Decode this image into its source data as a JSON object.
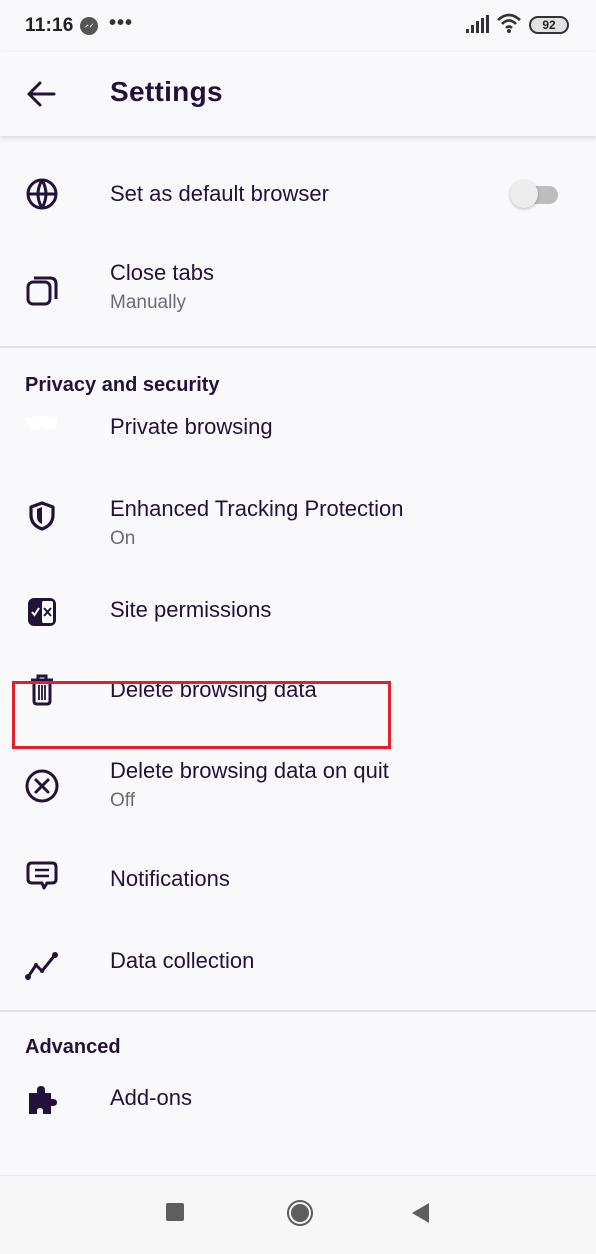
{
  "status_bar": {
    "time": "11:16",
    "overflow": "•••",
    "battery": "92",
    "icons": [
      "messenger-icon",
      "more-dots-icon",
      "signal-icon",
      "wifi-icon",
      "battery-icon"
    ]
  },
  "app_bar": {
    "back_icon": "arrow-back-icon",
    "title": "Settings"
  },
  "general_items": [
    {
      "icon": "globe-icon",
      "title": "Set as default browser",
      "toggle": false
    },
    {
      "icon": "tabs-icon",
      "title": "Close tabs",
      "subtitle": "Manually"
    }
  ],
  "privacy_section": {
    "header": "Privacy and security",
    "items": [
      {
        "icon": "private-mask-icon",
        "title": "Private browsing"
      },
      {
        "icon": "shield-icon",
        "title": "Enhanced Tracking Protection",
        "subtitle": "On"
      },
      {
        "icon": "permissions-icon",
        "title": "Site permissions"
      },
      {
        "icon": "trash-icon",
        "title": "Delete browsing data",
        "highlighted": true
      },
      {
        "icon": "close-circle-icon",
        "title": "Delete browsing data on quit",
        "subtitle": "Off"
      },
      {
        "icon": "chat-icon",
        "title": "Notifications"
      },
      {
        "icon": "chart-line-icon",
        "title": "Data collection"
      }
    ]
  },
  "advanced_section": {
    "header": "Advanced",
    "items": [
      {
        "icon": "puzzle-icon",
        "title": "Add-ons"
      }
    ]
  },
  "nav_bar": {
    "buttons": [
      "recents-icon",
      "home-icon",
      "back-triangle-icon"
    ]
  },
  "colors": {
    "text": "#20123a",
    "subtext": "#6b6b74",
    "highlight": "#e0202a",
    "background": "#f9f9fb"
  }
}
